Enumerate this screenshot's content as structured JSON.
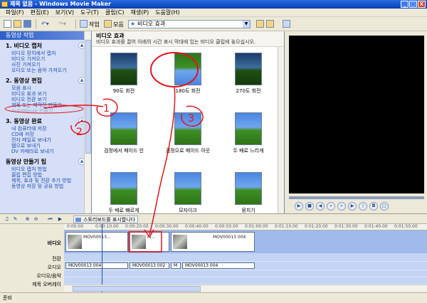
{
  "window": {
    "title": "제목 없음 - Windows Movie Maker",
    "buttons": [
      "_",
      "□",
      "X"
    ]
  },
  "menu": [
    "파일(F)",
    "편집(E)",
    "보기(V)",
    "도구(T)",
    "클립(C)",
    "재생(P)",
    "도움말(H)"
  ],
  "toolbar": {
    "tasks_label": "작업",
    "collections_label": "모음",
    "combo_value": "비디오 효과"
  },
  "sidebar": {
    "header": "동영상 작업",
    "sections": [
      {
        "title": "1. 비디오 캡처",
        "links": [
          "비디오 장치에서 캡처",
          "비디오 가져오기",
          "사진 가져오기",
          "오디오 또는 음악 가져오기"
        ]
      },
      {
        "title": "2. 동영상 편집",
        "links": [
          "모음 표시",
          "비디오 효과 보기",
          "비디오 전환 보기",
          "제목 또는 제작진 만들기",
          "AutoMovie 만들기"
        ]
      },
      {
        "title": "3. 동영상 완료",
        "links": [
          "내 컴퓨터에 저장",
          "CD에 저장",
          "전자 메일로 보내기",
          "웹으로 보내기",
          "DV 카메라로 보내기"
        ]
      },
      {
        "title": "동영상 만들기 팁",
        "links": [
          "비디오 캡처 방법",
          "클립 편집 방법",
          "제목, 효과 및 전환 추가 방법",
          "동영상 저장 및 공유 방법"
        ]
      }
    ]
  },
  "content": {
    "title": "비디오 효과",
    "description": "비디오 효과를 끌어 아래의 시간 표시 막대에 있는 비디오 클립에 놓으십시오.",
    "effects": [
      "90도 회전",
      "180도 회전",
      "270도 회전",
      "검정에서 페이드 인",
      "검정으로 페이드 아웃",
      "두 배로 느리게",
      "두 배로 빠르게",
      "모자이크",
      "뭉치기"
    ]
  },
  "timeline": {
    "storyboard_label": "스토리보드를 표시합니다",
    "tracks": [
      "비디오",
      "전환",
      "오디오",
      "오디오/음악",
      "제목 오버레이"
    ],
    "ruler": [
      "0:00:00",
      "0:00:10.00",
      "0:00:20.00",
      "0:00:30.00",
      "0:00:40.00",
      "0:00:50.00",
      "0:01:00.00",
      "0:01:10.00",
      "0:01:20.00",
      "0:01:30.00",
      "0:01:40.00",
      "0:01:50.00"
    ],
    "video_clips": [
      "MOV00013...",
      "M...",
      "MOV00013 004"
    ],
    "audio_clips": [
      "MOV00013 004",
      "MOV00013 002",
      "M",
      "MOV00013 004"
    ]
  },
  "annotations": [
    "1",
    "2",
    "3"
  ],
  "status": "준비",
  "colors": {
    "title_bar": "#0a3fb5",
    "sidebar_bg": "#d6dff7",
    "link": "#1e4fb7",
    "annotation_red": "#e0141e"
  }
}
